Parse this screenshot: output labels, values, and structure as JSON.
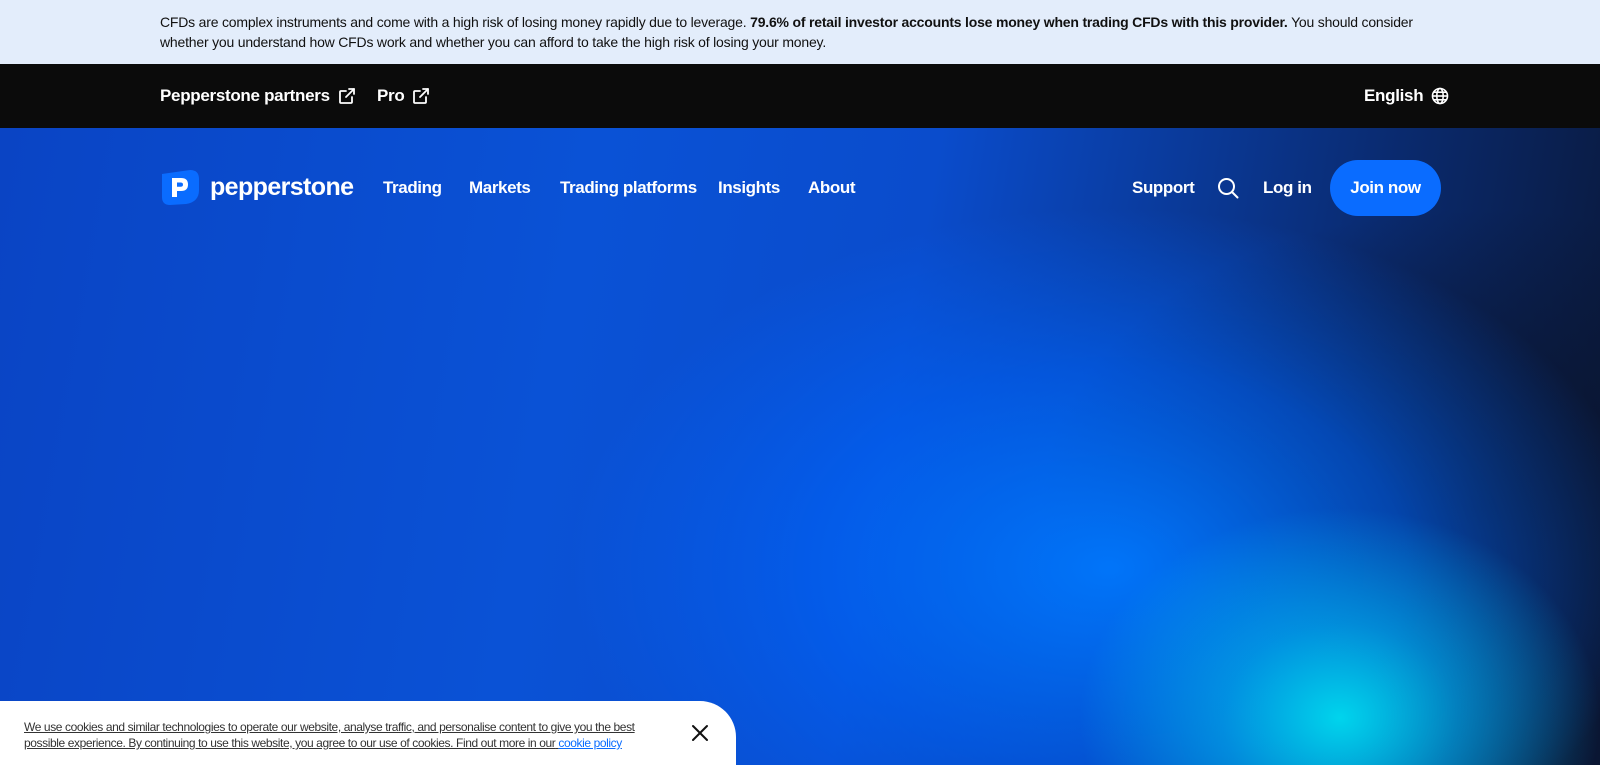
{
  "risk_warning": {
    "text_before": "CFDs are complex instruments and come with a high risk of losing money rapidly due to leverage.",
    "bold": "79.6% of retail investor accounts lose money when trading CFDs with this provider.",
    "text_after": "You should consider whether you understand how CFDs work and whether you can afford to take the high risk of losing your money."
  },
  "topbar": {
    "partners_label": "Pepperstone partners",
    "pro_label": "Pro",
    "language_label": "English",
    "icons": [
      "external-link-icon",
      "external-link-icon",
      "globe-icon"
    ]
  },
  "nav": {
    "logo_text": "pepperstone",
    "items": [
      {
        "label": "Trading"
      },
      {
        "label": "Markets"
      },
      {
        "label": "Trading platforms"
      },
      {
        "label": "Insights"
      },
      {
        "label": "About"
      }
    ],
    "support_label": "Support",
    "login_label": "Log in",
    "join_label": "Join now",
    "search_icon": "search-icon"
  },
  "cookie": {
    "text": "We use cookies and similar technologies to operate our website, analyse traffic, and personalise content to give you the best possible experience. By continuing to use this website, you agree to our use of cookies. Find out more in our",
    "link": "cookie policy",
    "close_icon": "close-icon"
  },
  "colors": {
    "banner_bg": "#e3edfb",
    "topbar_bg": "#0b0b0b",
    "accent": "#0a6cff",
    "hero_blue": "#0a4ccc",
    "glow_cyan": "#00dcf0"
  }
}
